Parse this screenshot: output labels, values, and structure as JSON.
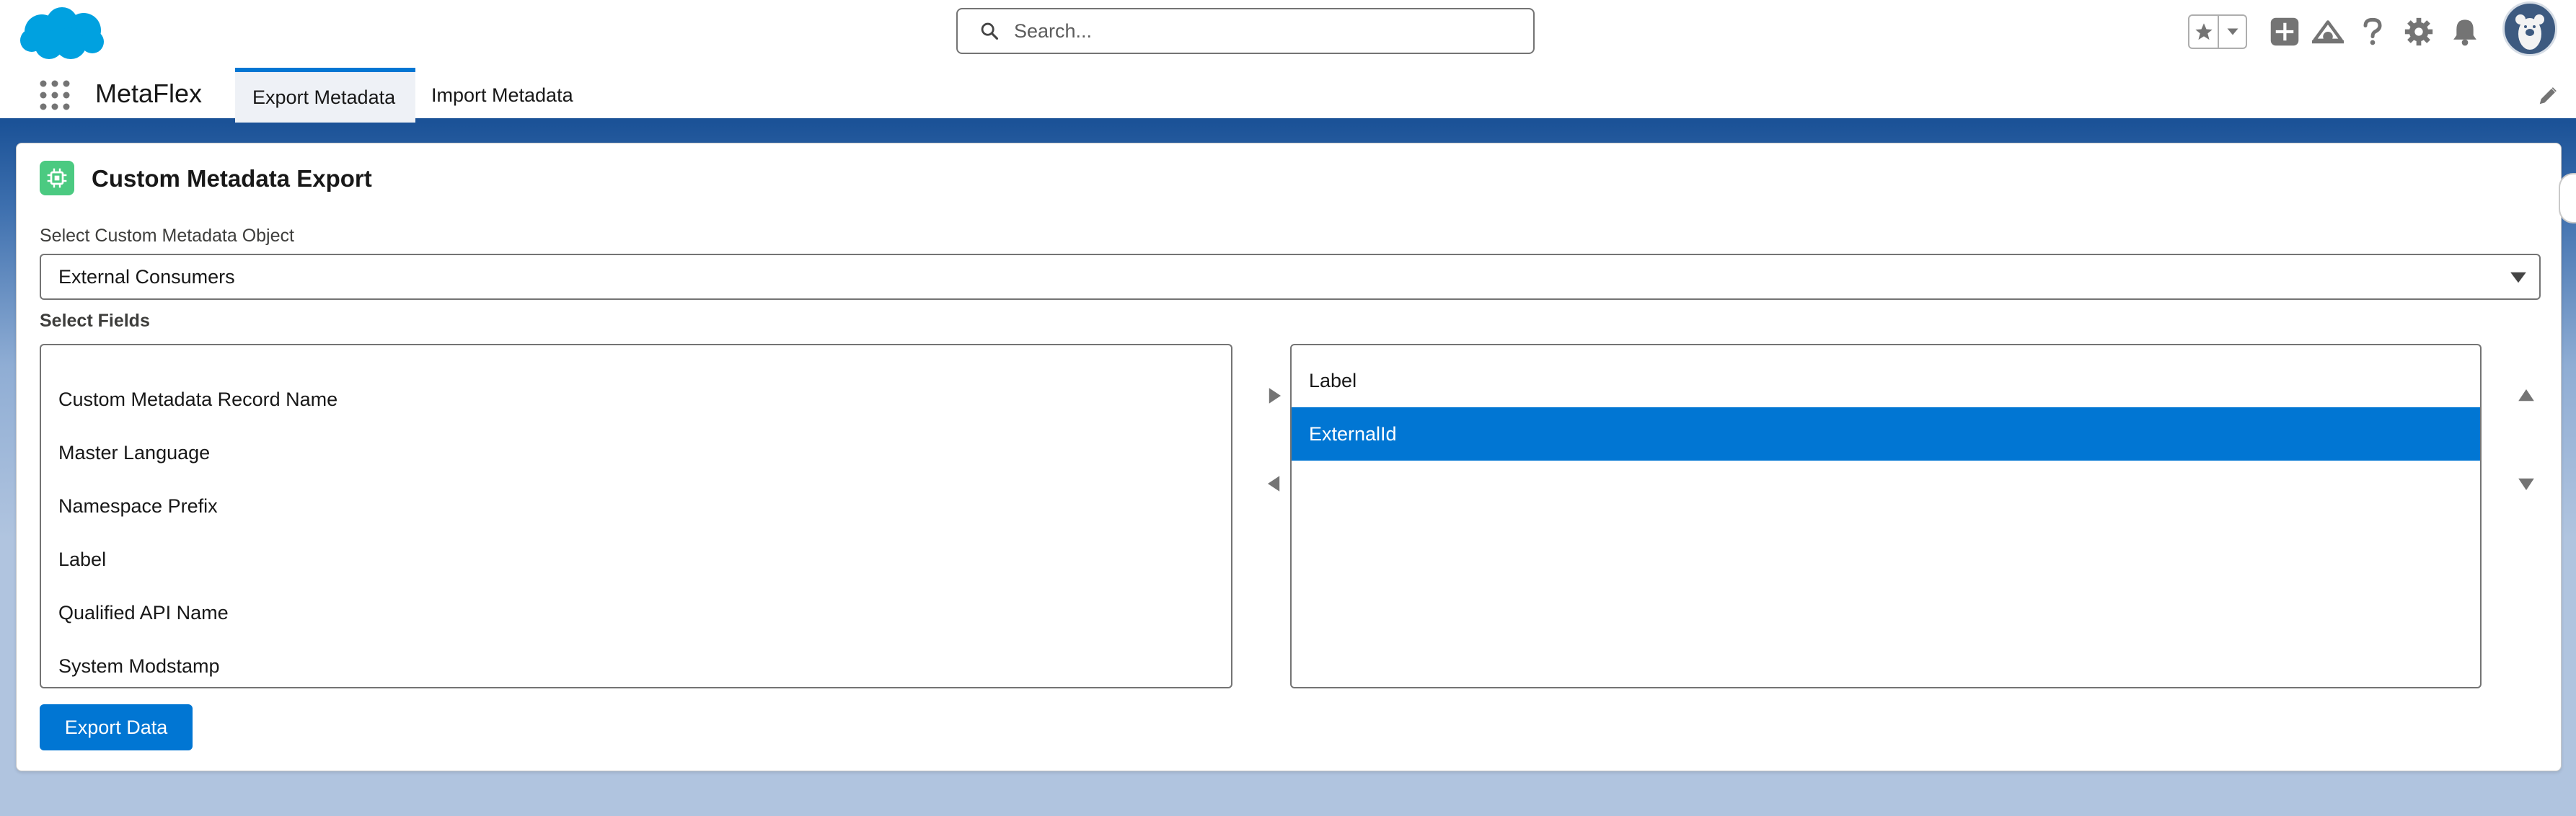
{
  "header": {
    "search_placeholder": "Search...",
    "icons": [
      "salesforce-cloud-logo",
      "search-icon",
      "star-icon",
      "chevron-down-icon",
      "add-icon",
      "trailhead-icon",
      "help-icon",
      "gear-icon",
      "bell-icon",
      "avatar"
    ]
  },
  "nav": {
    "app_name": "MetaFlex",
    "tabs": [
      {
        "label": "Export Metadata",
        "active": true
      },
      {
        "label": "Import Metadata",
        "active": false
      }
    ]
  },
  "card": {
    "title": "Custom Metadata Export",
    "object_label": "Select Custom Metadata Object",
    "object_value": "External Consumers",
    "fields_label": "Select Fields",
    "available_fields": [
      "Custom Metadata Record Name",
      "Master Language",
      "Namespace Prefix",
      "Label",
      "Qualified API Name",
      "System Modstamp"
    ],
    "selected_fields": [
      {
        "label": "Label",
        "selected": false
      },
      {
        "label": "ExternalId",
        "selected": true
      }
    ],
    "export_button": "Export Data"
  },
  "colors": {
    "brand": "#0176d3",
    "nav_border": "#1b5297",
    "card_icon": "#4bca81"
  }
}
